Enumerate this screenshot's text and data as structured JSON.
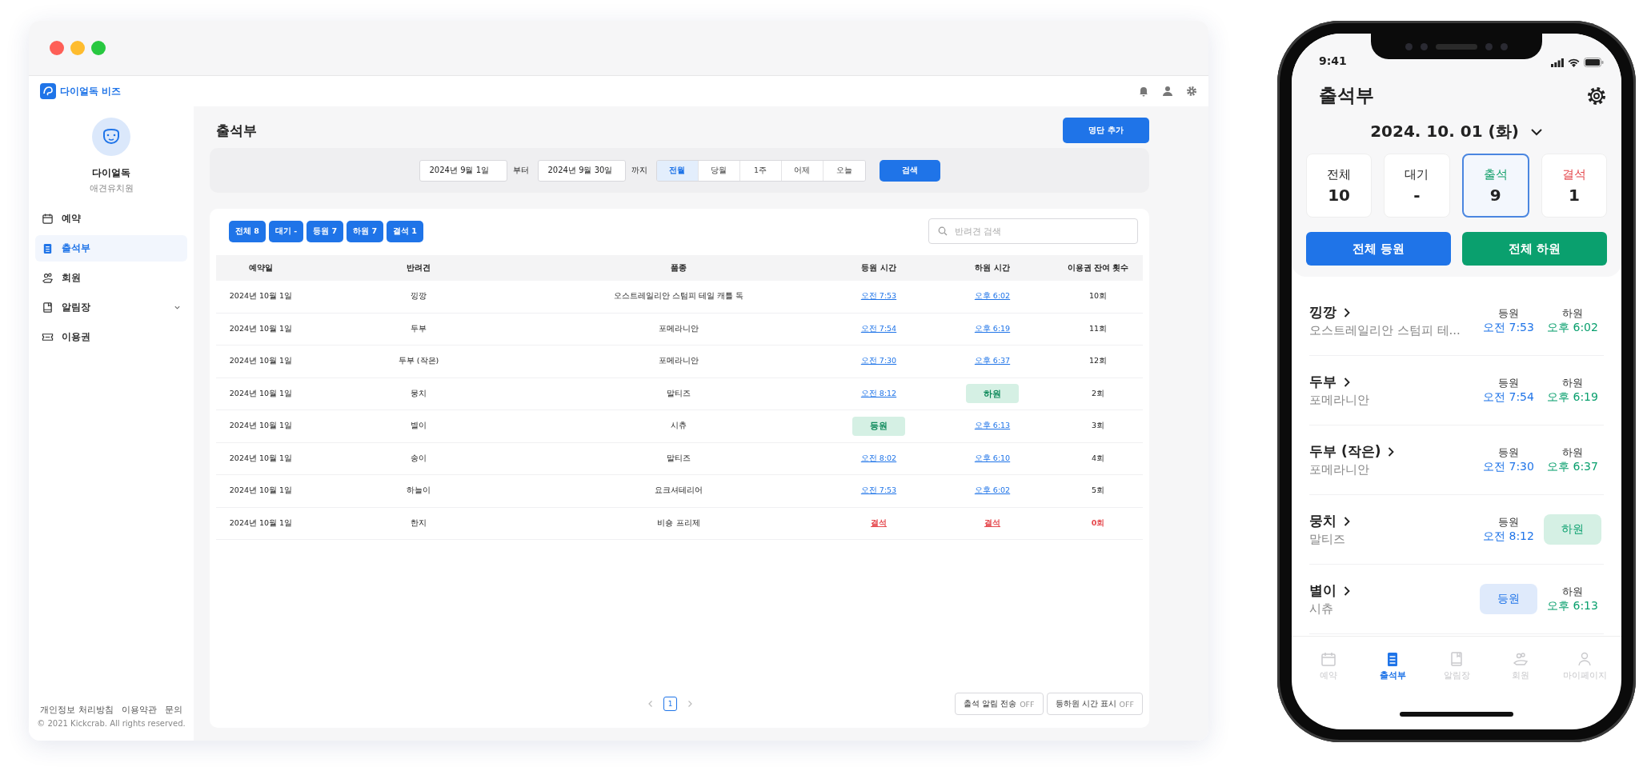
{
  "app": {
    "logo_text": "다이얼독 비즈",
    "profile": {
      "name": "다이얼독",
      "subtitle": "애견유치원"
    },
    "nav": [
      {
        "label": "예약",
        "selected": false,
        "expandable": false
      },
      {
        "label": "출석부",
        "selected": true,
        "expandable": false
      },
      {
        "label": "회원",
        "selected": false,
        "expandable": false
      },
      {
        "label": "알림장",
        "selected": false,
        "expandable": true
      },
      {
        "label": "이용권",
        "selected": false,
        "expandable": false
      }
    ],
    "footer_links": [
      "개인정보 처리방침",
      "이용약관",
      "문의"
    ],
    "copyright": "© 2021 Kickcrab. All rights reserved.",
    "page_title": "출석부",
    "add_button": "명단 추가",
    "date_from": "2024년 9월 1일",
    "from_label": "부터",
    "date_to": "2024년 9월 30일",
    "to_label": "까지",
    "periods": [
      {
        "label": "전월",
        "selected": true
      },
      {
        "label": "당월",
        "selected": false
      },
      {
        "label": "1주",
        "selected": false
      },
      {
        "label": "어제",
        "selected": false
      },
      {
        "label": "오늘",
        "selected": false
      }
    ],
    "search_button": "검색",
    "filters": [
      "전체 8",
      "대기 -",
      "등원 7",
      "하원 7",
      "결석 1"
    ],
    "search_placeholder": "반려견 검색",
    "table": {
      "columns": [
        "예약일",
        "반려견",
        "품종",
        "등원 시간",
        "하원 시간",
        "이용권 잔여 횟수"
      ],
      "rows": [
        {
          "date": "2024년 10월 1일",
          "dog": "낑깡",
          "breed": "오스트레일리안 스텀피 테일 캐틀 독",
          "in": {
            "kind": "time",
            "text": "오전 7:53"
          },
          "out": {
            "kind": "time",
            "text": "오후 6:02"
          },
          "remaining": "10회",
          "absent": false
        },
        {
          "date": "2024년 10월 1일",
          "dog": "두부",
          "breed": "포메라니안",
          "in": {
            "kind": "time",
            "text": "오전 7:54"
          },
          "out": {
            "kind": "time",
            "text": "오후 6:19"
          },
          "remaining": "11회",
          "absent": false
        },
        {
          "date": "2024년 10월 1일",
          "dog": "두부 (작은)",
          "breed": "포메라니안",
          "in": {
            "kind": "time",
            "text": "오전 7:30"
          },
          "out": {
            "kind": "time",
            "text": "오후 6:37"
          },
          "remaining": "12회",
          "absent": false
        },
        {
          "date": "2024년 10월 1일",
          "dog": "뭉치",
          "breed": "말티즈",
          "in": {
            "kind": "time",
            "text": "오전 8:12"
          },
          "out": {
            "kind": "button",
            "text": "하원"
          },
          "remaining": "2회",
          "absent": false
        },
        {
          "date": "2024년 10월 1일",
          "dog": "별이",
          "breed": "시츄",
          "in": {
            "kind": "button",
            "text": "등원"
          },
          "out": {
            "kind": "time",
            "text": "오후 6:13"
          },
          "remaining": "3회",
          "absent": false
        },
        {
          "date": "2024년 10월 1일",
          "dog": "송이",
          "breed": "말티즈",
          "in": {
            "kind": "time",
            "text": "오전 8:02"
          },
          "out": {
            "kind": "time",
            "text": "오후 6:10"
          },
          "remaining": "4회",
          "absent": false
        },
        {
          "date": "2024년 10월 1일",
          "dog": "하늘이",
          "breed": "요크셔테리어",
          "in": {
            "kind": "time",
            "text": "오전 7:53"
          },
          "out": {
            "kind": "time",
            "text": "오후 6:02"
          },
          "remaining": "5회",
          "absent": false
        },
        {
          "date": "2024년 10월 1일",
          "dog": "한지",
          "breed": "비숑 프리제",
          "in": {
            "kind": "absent",
            "text": "결석"
          },
          "out": {
            "kind": "absent",
            "text": "결석"
          },
          "remaining": "0회",
          "absent": true
        }
      ]
    },
    "page": "1",
    "toggles": [
      {
        "label": "출석 알림 전송",
        "state": "OFF",
        "on": false
      },
      {
        "label": "등하원 시간 표시",
        "state": "OFF",
        "on": false
      }
    ]
  },
  "phone": {
    "time": "9:41",
    "title": "출석부",
    "date": "2024. 10. 01 (화)",
    "stats": [
      {
        "label": "전체",
        "value": "10",
        "selected": false
      },
      {
        "label": "대기",
        "value": "-",
        "selected": false
      },
      {
        "label": "출석",
        "value": "9",
        "color": "#14a06b",
        "selected": true
      },
      {
        "label": "결석",
        "value": "1",
        "color": "#e5484d",
        "selected": false
      }
    ],
    "all_in": "전체 등원",
    "all_out": "전체 하원",
    "rows": [
      {
        "name": "낑깡",
        "breed": "오스트레일리안 스텀피 테...",
        "in": {
          "kind": "time",
          "label": "등원",
          "text": "오전 7:53"
        },
        "out": {
          "kind": "time",
          "label": "하원",
          "text": "오후 6:02"
        }
      },
      {
        "name": "두부",
        "breed": "포메라니안",
        "in": {
          "kind": "time",
          "label": "등원",
          "text": "오전 7:54"
        },
        "out": {
          "kind": "time",
          "label": "하원",
          "text": "오후 6:19"
        }
      },
      {
        "name": "두부 (작은)",
        "breed": "포메라니안",
        "in": {
          "kind": "time",
          "label": "등원",
          "text": "오전 7:30"
        },
        "out": {
          "kind": "time",
          "label": "하원",
          "text": "오후 6:37"
        }
      },
      {
        "name": "뭉치",
        "breed": "말티즈",
        "in": {
          "kind": "time",
          "label": "등원",
          "text": "오전 8:12"
        },
        "out": {
          "kind": "button",
          "label": "하원"
        }
      },
      {
        "name": "별이",
        "breed": "시츄",
        "in": {
          "kind": "button",
          "label": "등원"
        },
        "out": {
          "kind": "time",
          "label": "하원",
          "text": "오후 6:13"
        }
      }
    ],
    "tabs": [
      {
        "label": "예약",
        "selected": false
      },
      {
        "label": "출석부",
        "selected": true
      },
      {
        "label": "알림장",
        "selected": false
      },
      {
        "label": "회원",
        "selected": false
      },
      {
        "label": "마이페이지",
        "selected": false
      }
    ]
  }
}
